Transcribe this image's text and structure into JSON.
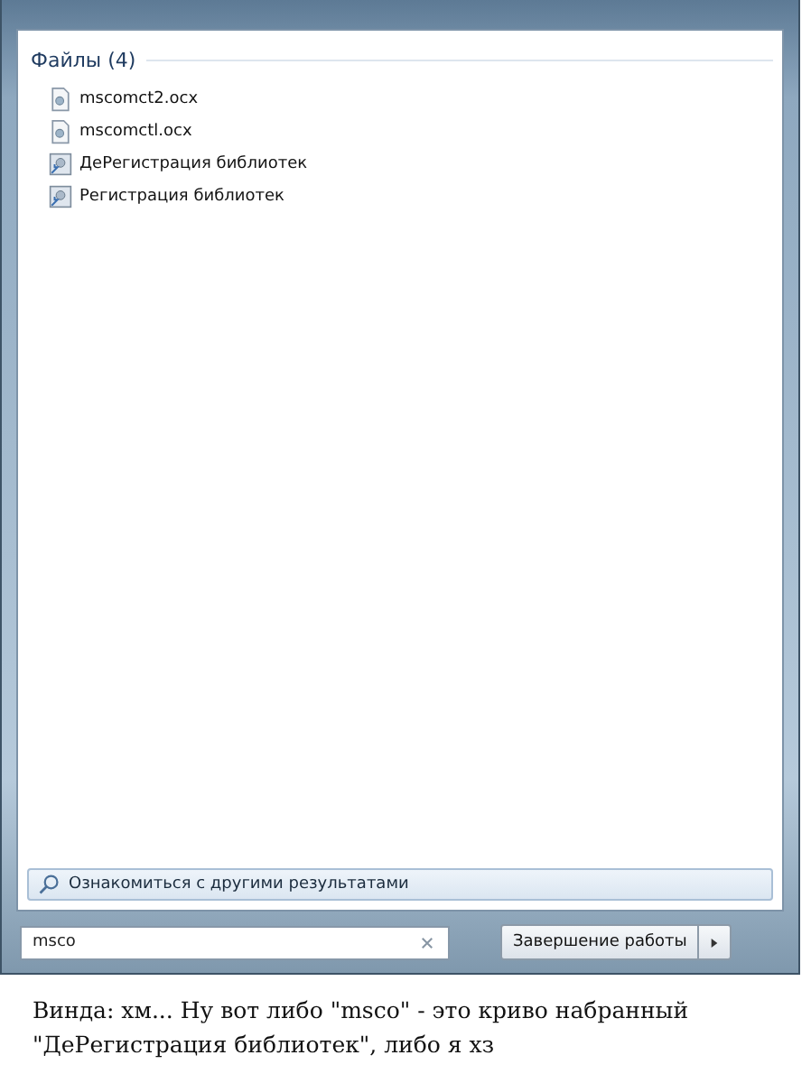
{
  "results": {
    "group_title": "Файлы (4)",
    "items": [
      {
        "label": "mscomct2.ocx",
        "kind": "file"
      },
      {
        "label": "mscomctl.ocx",
        "kind": "file"
      },
      {
        "label": "ДеРегистрация библиотек",
        "kind": "shortcut"
      },
      {
        "label": "Регистрация библиотек",
        "kind": "shortcut"
      }
    ]
  },
  "more_results": "Ознакомиться с другими результатами",
  "search": {
    "value": "msco"
  },
  "shutdown_button": "Завершение работы",
  "caption": "Винда: хм... Ну вот либо \"msco\" - это криво набранный \"ДеРегистрация библиотек\", либо я хз"
}
